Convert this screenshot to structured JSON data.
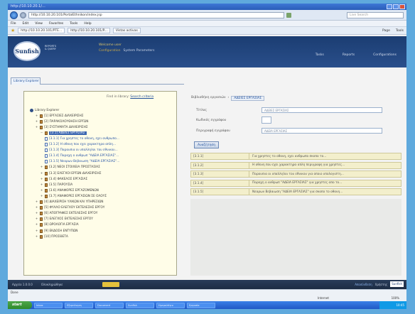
{
  "browser": {
    "title": "http://10.10.20.1/...",
    "url": "http://10.10.20.101/PortalEthnikon/index.jsp",
    "search_placeholder": "Live Search",
    "menu": [
      "File",
      "Edit",
      "View",
      "Favorites",
      "Tools",
      "Help"
    ],
    "tabs": [
      "http://10.10.20.101/PTE...",
      "http://10.10.20.101/P...",
      "Vistas activas"
    ],
    "tools": [
      "Page",
      "Tools"
    ],
    "status_text": "Done",
    "zone_text": "Internet",
    "zoom_text": "100%"
  },
  "app": {
    "logo_text": "Sunfish",
    "logo_sub": "REPORTS & QUERY",
    "welcome_line1": "Welcome user",
    "welcome_line2a": "Configuration",
    "welcome_line2b": "System Parameters",
    "menu": [
      "Tasks",
      "Reports",
      "Configurations"
    ]
  },
  "left": {
    "tab_label": "Library Explorer",
    "head_text": "Find in library:",
    "head_link": "Search criteria",
    "tree": [
      {
        "label": "Library Explorer",
        "level": 0,
        "type": "root"
      },
      {
        "label": "[1] ΕΡΓΑΣΙΕΣ ΔΙΑΧΕΙΡΙΣΗΣ",
        "level": 1,
        "type": "book"
      },
      {
        "label": "[2] ΠΑΡΑΚΟΛΟΥΘΗΣΗ ΕΡΓΩΝ",
        "level": 1,
        "type": "book"
      },
      {
        "label": "[3] ΣΥΣΤΗΜΑΤΑ ΔΙΑΧΕΙΡΙΣΗΣ",
        "level": 1,
        "type": "book"
      },
      {
        "label": "[3.1] ΑΔΕΙΕΣ ΕΡΓΑΣΙΑΣ",
        "level": 2,
        "type": "book",
        "selected": true
      },
      {
        "label": "[3.1.1] Για χρηστες το οθονη, εχει ανθρωπο...",
        "level": 3,
        "type": "doc"
      },
      {
        "label": "[3.1.2] Η οθονη που εχει χαρακτηρα απλη...",
        "level": 3,
        "type": "doc"
      },
      {
        "label": "[3.1.3] Παρουσια οι υπαλληλοι του εθνικου...",
        "level": 3,
        "type": "doc"
      },
      {
        "label": "[3.1.4] Παροχη ο ανθρωπ \"ΑΔΕΙΑ ΕΡΓΑΣΙΑΣ\"...",
        "level": 3,
        "type": "doc"
      },
      {
        "label": "[3.1.5] Νεαρων Βεβαιωση \"ΑΔΕΙΑ ΕΡΓΑΣΙΑΣ\"...",
        "level": 3,
        "type": "doc"
      },
      {
        "label": "[3.2] ΝΕΟΙ ΣΤΟΙΧΕΙΑ ΠΡΟΣΤΑΣΙΑΣ",
        "level": 2,
        "type": "book"
      },
      {
        "label": "[3.3] ΕΛΕΓΧΟΙ ΕΡΓΩΝ ΔΙΑΧΕΙΡΙΣΗΣ",
        "level": 2,
        "type": "book"
      },
      {
        "label": "[3.4] ΦΑΚΕΛΟΣ ΕΡΓΑΣΙΑΣ",
        "level": 2,
        "type": "book"
      },
      {
        "label": "[3.5] ΠΑΡΟΥΣΙΑ",
        "level": 2,
        "type": "book"
      },
      {
        "label": "[3.6] ΑΝΑΦΟΡΕΣ ΕΡΓΑΖΟΜΕΝΩΝ",
        "level": 2,
        "type": "book"
      },
      {
        "label": "[3.7] ΑΝΑΦΟΡΕΣ ΕΡΓΑΣΙΩΝ ΣΕ ΟΛΟΥΣ",
        "level": 2,
        "type": "book"
      },
      {
        "label": "[4] ΔΙΑΧΕΙΡΙΣΗ ΥΛΙΚΩΝ ΚΑΙ ΥΠΗΡΕΣΙΩΝ",
        "level": 1,
        "type": "book"
      },
      {
        "label": "[5] ΦΥΛΛΟ ΕΛΕΓΧΟΥ ΕΚΤΕΛΕΣΗΣ ΕΡΓΟΥ",
        "level": 1,
        "type": "book"
      },
      {
        "label": "[6] ΑΠΟΓΡΑΦΕΣ ΕΚΤΕΛΕΣΗΣ ΕΡΓΟΥ",
        "level": 1,
        "type": "book"
      },
      {
        "label": "[7] ΕΛΕΓΧΟΣ ΕΚΤΕΛΕΣΗΣ ΕΡΓΟΥ",
        "level": 1,
        "type": "book"
      },
      {
        "label": "[8] ΩΡΟΛΟΓΙΑ ΕΡΓΑΣΙΑ",
        "level": 1,
        "type": "book"
      },
      {
        "label": "[9] ΕΚΔΟΣΗ ΕΝΤΥΠΩΝ",
        "level": 1,
        "type": "book"
      },
      {
        "label": "[10] ΠΡΟΣΘΕΤΑ",
        "level": 1,
        "type": "book"
      }
    ]
  },
  "right": {
    "breadcrumb_a": "Βιβλιοθήκη εργασιών",
    "breadcrumb_b": "ΑΔΕΙΕΣ ΕΡΓΑΣΙΑΣ",
    "field1_label": "Τίτλος",
    "field1_value": "ΑΔΕΙΕΣ ΕΡΓΑΣΙΑΣ",
    "field2_label": "Κωδικός εγγράφου",
    "field3_label": "Περιγραφή εγγράφου",
    "field3_value": "ΑΔΕΙΑ ΕΡΓΑΣΙΑΣ",
    "search_button": "Αναζήτηση",
    "results": [
      {
        "code": "[3.1.1]",
        "desc": "Για χρηστες το οθονη, εχει ανθρωπο σκοπο το..."
      },
      {
        "code": "[3.1.2]",
        "desc": "Η οθονη που εχει χαρακτηρα απλη περιγραφη για χρηστες..."
      },
      {
        "code": "[3.1.3]",
        "desc": "Παρουσια οι υπαλληλοι του εθνικου για οποιο υπολογιστη..."
      },
      {
        "code": "[3.1.4]",
        "desc": "Παροχη ο ανθρωπ \"ΑΔΕΙΑ ΕΡΓΑΣΙΑΣ\" για χρηστες απο το..."
      },
      {
        "code": "[3.1.5]",
        "desc": "Νεαρων Βεβαιωση \"ΑΔΕΙΑ ΕΡΓΑΣΙΑΣ\" για σκοπο το οθονη..."
      }
    ]
  },
  "footer": {
    "left_a": "Αρχείο 1.0.0.0",
    "left_b": "Ολοκληρώθηκε",
    "right_link": "Αποσύνδεση",
    "right_text": "Χρήστης",
    "badge": "Sunfish"
  },
  "taskbar": {
    "start": "start",
    "items": [
      "Inbox",
      "Εξερεύνηση",
      "Document",
      "Sunfish",
      "Ημερολόγιο",
      "Εργασία"
    ],
    "clock": "10:45"
  }
}
